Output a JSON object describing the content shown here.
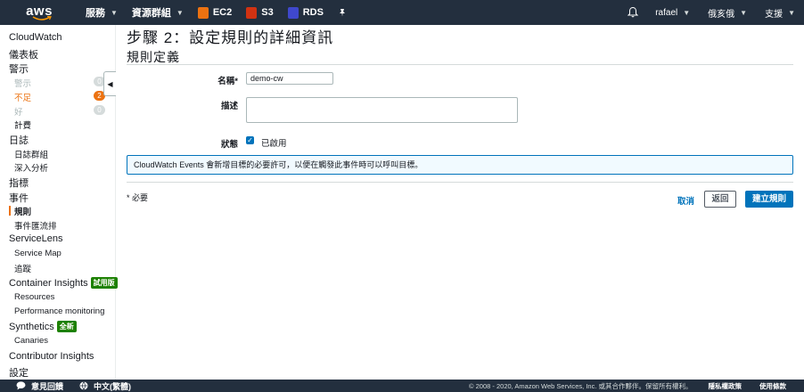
{
  "topnav": {
    "logo": "aws",
    "services": "服務",
    "resource_groups": "資源群組",
    "shortcuts": [
      {
        "label": "EC2",
        "color": "#ec7211"
      },
      {
        "label": "S3",
        "color": "#d13212"
      },
      {
        "label": "RDS",
        "color": "#3f48cc"
      }
    ],
    "user": "rafael",
    "region": "俄亥俄",
    "support": "支援"
  },
  "sidebar": {
    "items": [
      {
        "label": "CloudWatch"
      },
      {
        "label": "儀表板"
      },
      {
        "label": "警示"
      },
      {
        "label": "警示",
        "count": "0"
      },
      {
        "label": "不足",
        "count": "2"
      },
      {
        "label": "好",
        "count": "0"
      },
      {
        "label": "計費"
      },
      {
        "label": "日誌"
      },
      {
        "label": "日誌群組"
      },
      {
        "label": "深入分析"
      },
      {
        "label": "指標"
      },
      {
        "label": "事件"
      },
      {
        "label": "規則"
      },
      {
        "label": "事件匯流排"
      },
      {
        "label": "ServiceLens"
      },
      {
        "label": "Service Map"
      },
      {
        "label": "追蹤"
      },
      {
        "label": "Container Insights",
        "tag": "試用版"
      },
      {
        "label": "Resources"
      },
      {
        "label": "Performance monitoring"
      },
      {
        "label": "Synthetics",
        "tag": "全新"
      },
      {
        "label": "Canaries"
      },
      {
        "label": "Contributor Insights"
      },
      {
        "label": "設定"
      }
    ]
  },
  "main": {
    "page_title": "步驟 2：設定規則的詳細資訊",
    "section_title": "規則定義",
    "name_label": "名稱*",
    "name_value": "demo-cw",
    "description_label": "描述",
    "state_label": "狀態",
    "state_checkbox_text": "已啟用",
    "info_message": "CloudWatch Events 會新增目標的必要許可，以便在觸發此事件時可以呼叫目標。",
    "required_note": "* 必要",
    "cancel": "取消",
    "back": "返回",
    "create": "建立規則"
  },
  "footer": {
    "feedback": "意見回饋",
    "language": "中文(繁體)",
    "copyright": "© 2008 - 2020, Amazon Web Services, Inc. 或其合作夥伴。保留所有權利。",
    "privacy": "隱私權政策",
    "terms": "使用條款"
  },
  "colors": {
    "nav_bg": "#232f3e",
    "accent_orange": "#ec7211",
    "primary_blue": "#0073bb",
    "new_tag_green": "#1d8102"
  }
}
